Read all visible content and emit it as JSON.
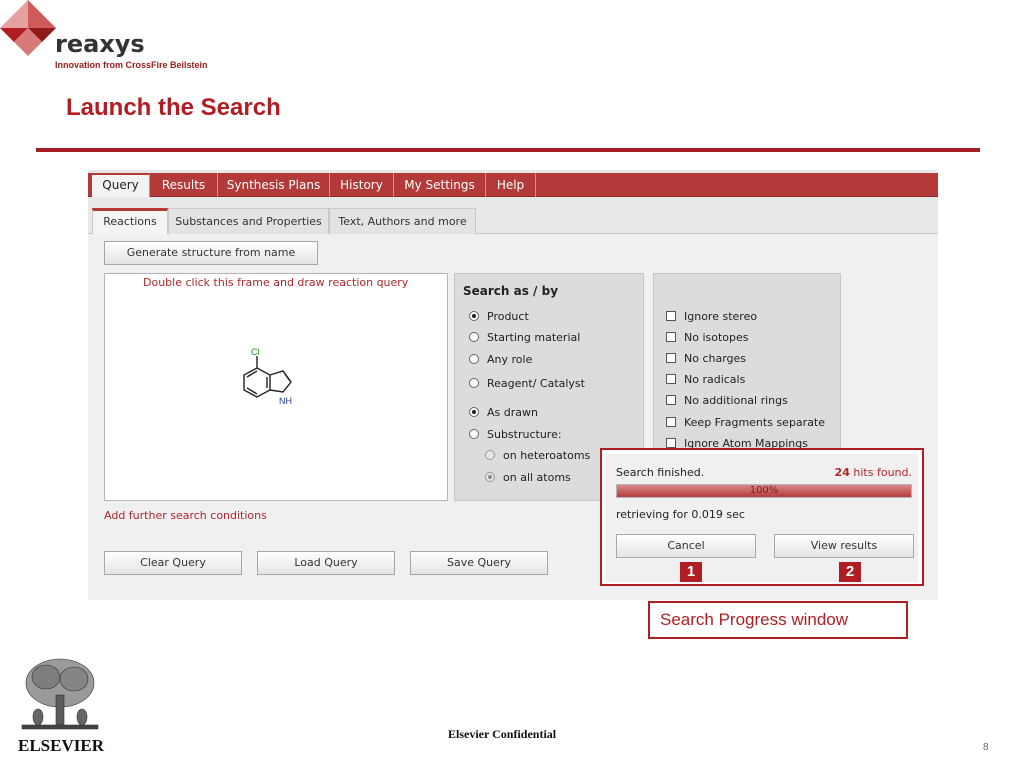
{
  "branding": {
    "logo_word": "reaxys",
    "logo_tagline": "Innovation from CrossFire Beilstein",
    "footer_logo": "ELSEVIER"
  },
  "slide": {
    "title": "Launch the Search",
    "footer_text": "Elsevier Confidential",
    "page_number": "8",
    "callout": "Search Progress window",
    "badges": [
      "1",
      "2"
    ]
  },
  "menubar": {
    "items": [
      "Query",
      "Results",
      "Synthesis Plans",
      "History",
      "My Settings",
      "Help"
    ],
    "active": "Query"
  },
  "subtabs": {
    "items": [
      "Reactions",
      "Substances and Properties",
      "Text, Authors and more"
    ],
    "active": "Reactions"
  },
  "query": {
    "generate_button": "Generate structure from name",
    "draw_hint": "Double click this frame and draw reaction query",
    "structure_labels": {
      "chlorine": "Cl",
      "nh": "NH"
    },
    "add_conditions": "Add further search conditions",
    "buttons": {
      "clear": "Clear Query",
      "load": "Load Query",
      "save": "Save Query"
    }
  },
  "search_as": {
    "title": "Search as / by",
    "role_options": [
      "Product",
      "Starting material",
      "Any role",
      "Reagent/ Catalyst"
    ],
    "role_selected": "Product",
    "match_options": [
      "As drawn",
      "Substructure:"
    ],
    "match_selected": "As drawn",
    "sub_options": [
      "on heteroatoms",
      "on all atoms"
    ],
    "sub_selected": "on all atoms"
  },
  "options": {
    "checkboxes": [
      "Ignore stereo",
      "No isotopes",
      "No charges",
      "No radicals",
      "No additional rings",
      "Keep Fragments separate",
      "Ignore Atom Mappings"
    ]
  },
  "progress": {
    "status": "Search finished.",
    "hits_count": "24",
    "hits_suffix": "hits found.",
    "percent_label": "100%",
    "percent_value": 100,
    "retrieving": "retrieving for 0.019 sec",
    "cancel_button": "Cancel",
    "view_button": "View results"
  },
  "colors": {
    "brand_red": "#b01e23",
    "menubar_red": "#b43a3a"
  }
}
